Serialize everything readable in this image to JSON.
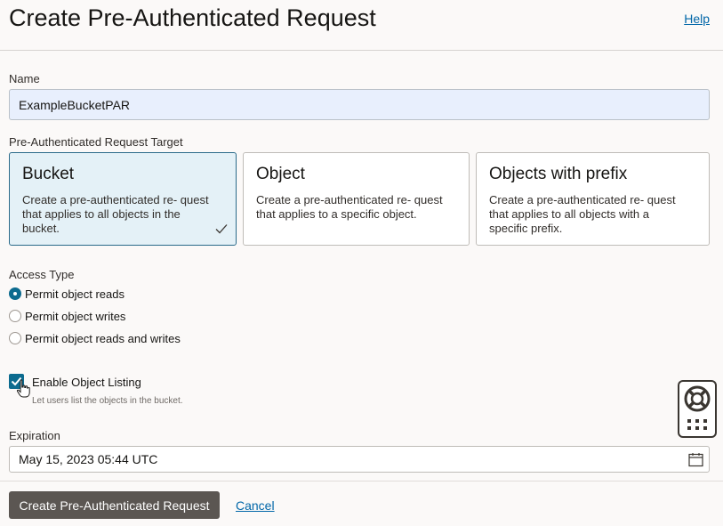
{
  "header": {
    "title": "Create Pre-Authenticated Request",
    "help_label": "Help"
  },
  "form": {
    "name_label": "Name",
    "name_value": "ExampleBucketPAR",
    "target_label": "Pre-Authenticated Request Target",
    "targets": [
      {
        "title": "Bucket",
        "description": "Create a pre-authenticated re- quest that applies to all objects in the bucket.",
        "selected": true
      },
      {
        "title": "Object",
        "description": "Create a pre-authenticated re- quest that applies to a specific object.",
        "selected": false
      },
      {
        "title": "Objects with prefix",
        "description": "Create a pre-authenticated re- quest that applies to all objects with a specific prefix.",
        "selected": false
      }
    ],
    "access_label": "Access Type",
    "access_options": [
      {
        "label": "Permit object reads",
        "checked": true
      },
      {
        "label": "Permit object writes",
        "checked": false
      },
      {
        "label": "Permit object reads and writes",
        "checked": false
      }
    ],
    "listing_label": "Enable Object Listing",
    "listing_help": "Let users list the objects in the bucket.",
    "listing_checked": true,
    "expiration_label": "Expiration",
    "expiration_value": "May 15, 2023 05:44 UTC"
  },
  "footer": {
    "create_label": "Create Pre-Authenticated Request",
    "cancel_label": "Cancel"
  },
  "colors": {
    "accent": "#0c6b8f",
    "selected_card_bg": "#e4f1f7",
    "primary_button": "#5b5652",
    "link": "#0066a8"
  },
  "icons": [
    "check-icon",
    "calendar-icon",
    "lifebuoy-icon",
    "grid-dots-icon",
    "hand-cursor-icon"
  ]
}
